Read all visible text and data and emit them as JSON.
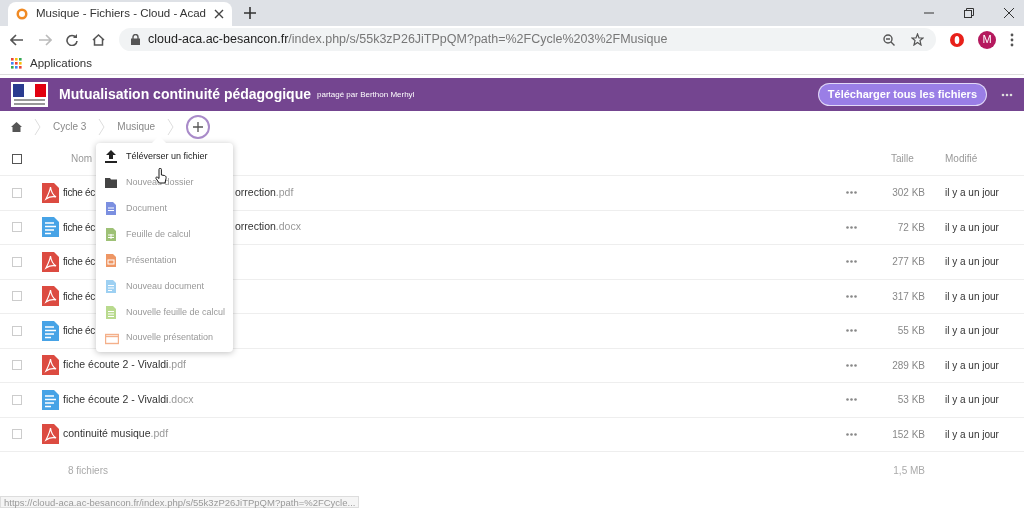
{
  "browser": {
    "tab_title": "Musique - Fichiers - Cloud - Acad",
    "url_host": "cloud-aca.ac-besancon.fr",
    "url_path": "/index.php/s/55k3zP26JiTPpQM?path=%2FCycle%203%2FMusique",
    "profile_initial": "M",
    "bookmarks": [
      "Applications"
    ]
  },
  "header": {
    "title": "Mutualisation continuité pédagogique",
    "subtitle": "partagé par Berthon Merhyl",
    "download_button": "Télécharger tous les fichiers"
  },
  "breadcrumb": [
    "Cycle 3",
    "Musique"
  ],
  "table": {
    "columns": {
      "name": "Nom",
      "size": "Taille",
      "modified": "Modifié"
    },
    "select_all_checked": false,
    "rows": [
      {
        "kind": "pdf",
        "checked": false,
        "name_parts": [
          "fiche éc",
          "orrection"
        ],
        "extension": ".pdf",
        "size": "302 KB",
        "modified": "il y a un jour"
      },
      {
        "kind": "docx",
        "checked": false,
        "name_parts": [
          "fiche éc",
          "orrection"
        ],
        "extension": ".docx",
        "size": "72 KB",
        "modified": "il y a un jour"
      },
      {
        "kind": "pdf",
        "checked": false,
        "name_parts": [
          "fiche éc"
        ],
        "extension": "",
        "size": "277 KB",
        "modified": "il y a un jour"
      },
      {
        "kind": "pdf",
        "checked": false,
        "name_parts": [
          "fiche éc"
        ],
        "extension": "",
        "size": "317 KB",
        "modified": "il y a un jour"
      },
      {
        "kind": "docx",
        "checked": false,
        "name_parts": [
          "fiche éc"
        ],
        "extension": "",
        "size": "55 KB",
        "modified": "il y a un jour"
      },
      {
        "kind": "pdf",
        "checked": false,
        "name_parts": [
          "fiche écoute 2 - Vivaldi"
        ],
        "extension": ".pdf",
        "size": "289 KB",
        "modified": "il y a un jour"
      },
      {
        "kind": "docx",
        "checked": false,
        "name_parts": [
          "fiche écoute 2 - Vivaldi"
        ],
        "extension": ".docx",
        "size": "53 KB",
        "modified": "il y a un jour"
      },
      {
        "kind": "pdf",
        "checked": false,
        "name_parts": [
          "continuité musique"
        ],
        "extension": ".pdf",
        "size": "152 KB",
        "modified": "il y a un jour"
      }
    ],
    "summary": {
      "count": "8 fichiers",
      "total": "1,5 MB"
    }
  },
  "new_menu": [
    {
      "kind": "upload",
      "label": "Téléverser un fichier",
      "highlighted": true
    },
    {
      "kind": "folder",
      "label": "Nouveau dossier",
      "highlighted": false
    },
    {
      "kind": "document",
      "label": "Document",
      "highlighted": false
    },
    {
      "kind": "spreadsheet",
      "label": "Feuille de calcul",
      "highlighted": false
    },
    {
      "kind": "presentation",
      "label": "Présentation",
      "highlighted": false
    },
    {
      "kind": "new-document",
      "label": "Nouveau document",
      "highlighted": false
    },
    {
      "kind": "new-spreadsheet",
      "label": "Nouvelle feuille de calcul",
      "highlighted": false
    },
    {
      "kind": "new-presentation",
      "label": "Nouvelle présentation",
      "highlighted": false
    }
  ],
  "status_url": "https://cloud-aca.ac-besancon.fr/index.php/s/55k3zP26JiTPpQM?path=%2FCycle..."
}
